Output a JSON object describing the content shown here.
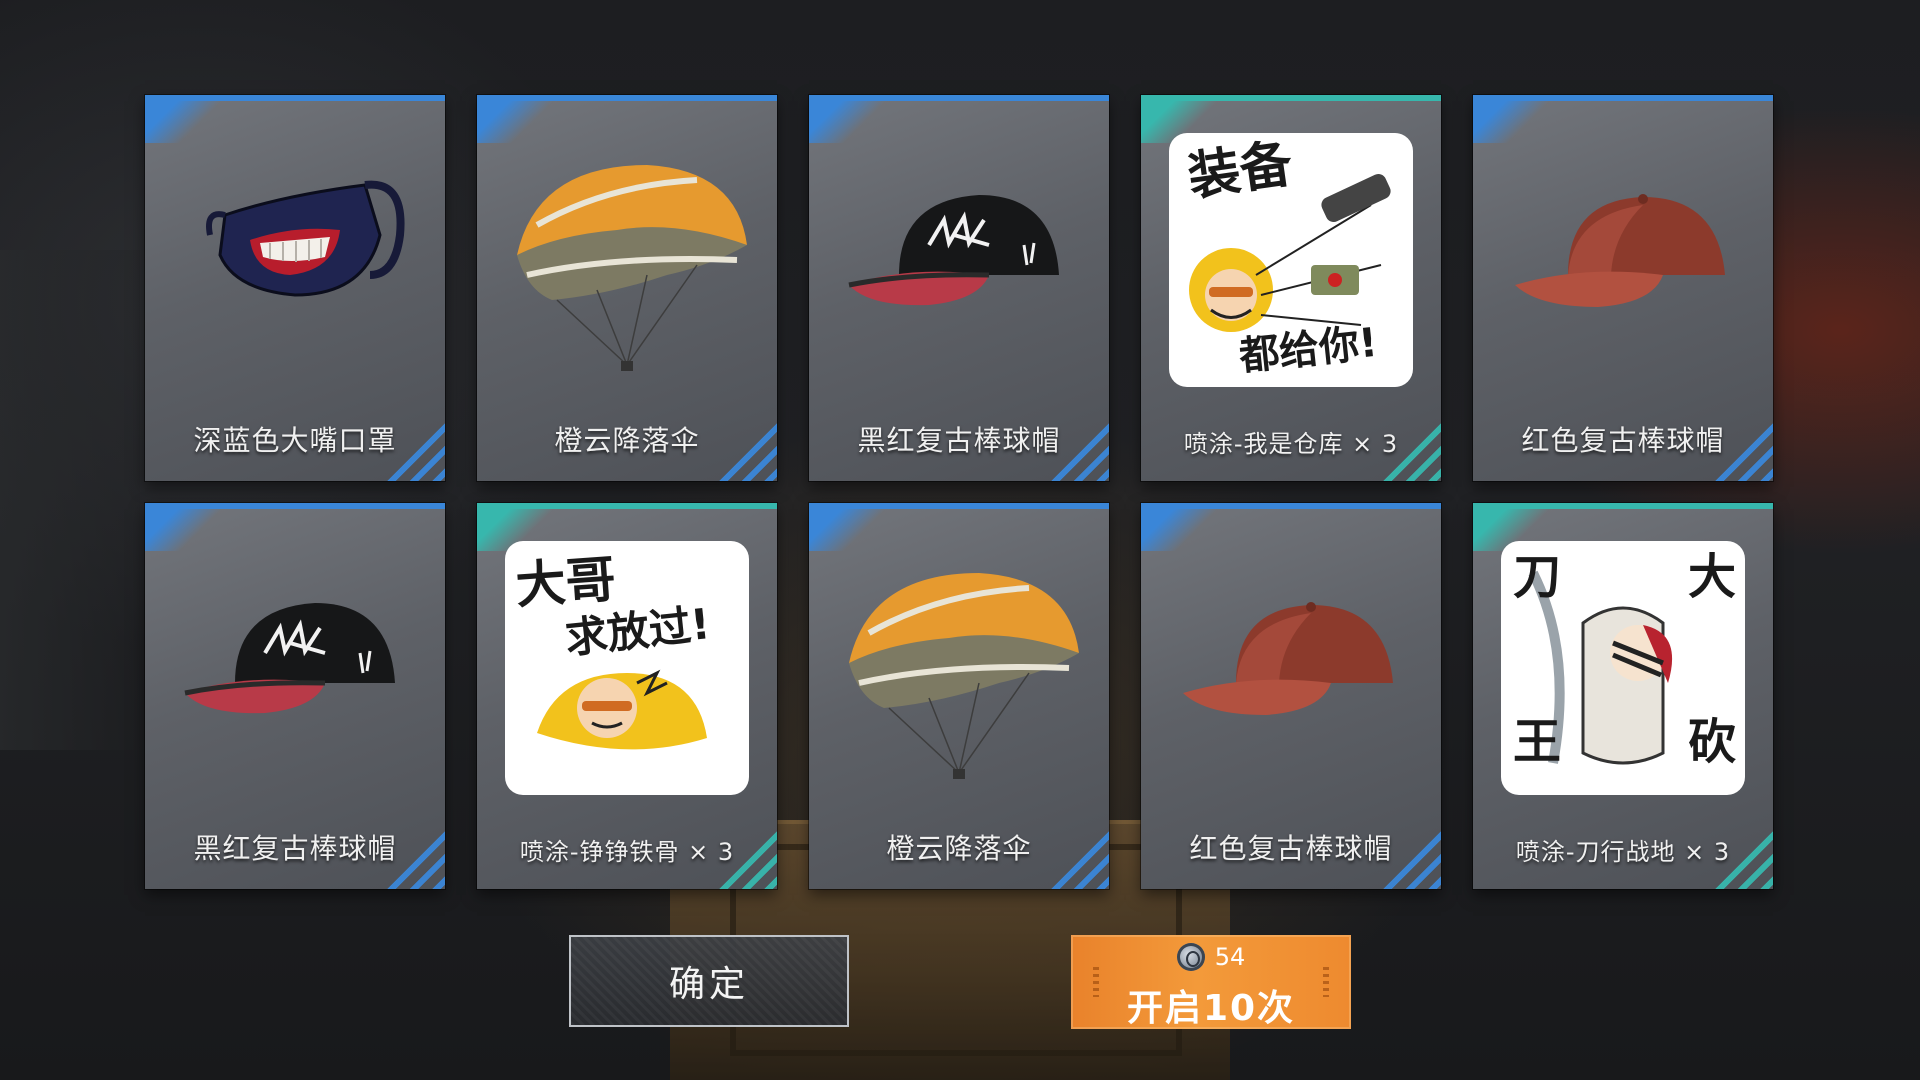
{
  "rewards": [
    {
      "name": "深蓝色大嘴口罩",
      "kind": "mask"
    },
    {
      "name": "橙云降落伞",
      "kind": "parachute"
    },
    {
      "name": "黑红复古棒球帽",
      "kind": "cap-black"
    },
    {
      "name": "喷涂-我是仓库 × 3",
      "kind": "spray",
      "sticker_text": [
        "装备",
        "都给你!"
      ]
    },
    {
      "name": "红色复古棒球帽",
      "kind": "cap-red"
    },
    {
      "name": "黑红复古棒球帽",
      "kind": "cap-black"
    },
    {
      "name": "喷涂-铮铮铁骨 × 3",
      "kind": "spray",
      "sticker_text": [
        "大哥",
        "求放过!"
      ]
    },
    {
      "name": "橙云降落伞",
      "kind": "parachute"
    },
    {
      "name": "红色复古棒球帽",
      "kind": "cap-red"
    },
    {
      "name": "喷涂-刀行战地 × 3",
      "kind": "spray",
      "sticker_text": [
        "刀",
        "大",
        "王",
        "砍"
      ]
    }
  ],
  "buttons": {
    "confirm_label": "确定",
    "open_label": "开启10次",
    "open_cost": "54",
    "open_cost_icon": "coin-icon"
  },
  "colors": {
    "rarity_blue": "#3a86d8",
    "rarity_teal": "#37b7ad",
    "open_button": "#f39a3a"
  }
}
